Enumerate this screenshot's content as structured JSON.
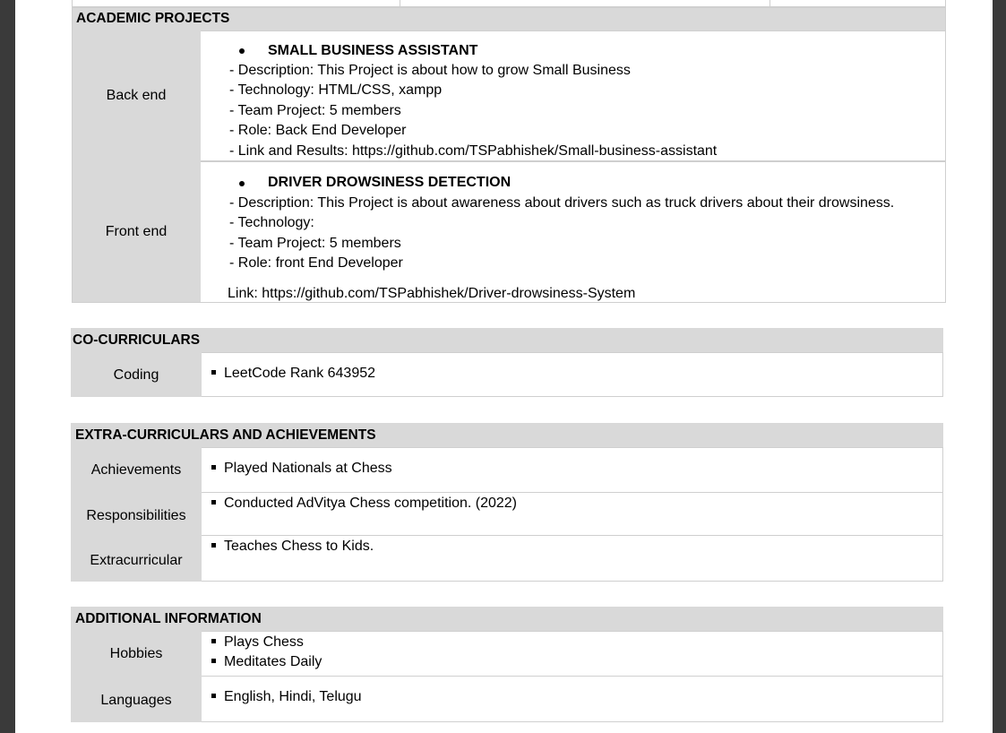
{
  "academic_projects": {
    "header": "ACADEMIC PROJECTS",
    "rows": [
      {
        "label": "Back end",
        "title": "SMALL BUSINESS ASSISTANT",
        "lines": [
          "- Description: This Project is about how to grow Small Business",
          "- Technology: HTML/CSS, xampp",
          "- Team Project: 5 members",
          "- Role:  Back End Developer",
          "- Link and Results: https://github.com/TSPabhishek/Small-business-assistant"
        ]
      },
      {
        "label": "Front end",
        "title": "DRIVER DROWSINESS DETECTION",
        "lines": [
          "- Description: This Project is about awareness about drivers such as truck drivers about their drowsiness.",
          "- Technology:",
          "- Team Project: 5 members",
          "- Role:  front End Developer"
        ],
        "link": "Link: https://github.com/TSPabhishek/Driver-drowsiness-System"
      }
    ]
  },
  "co_curriculars": {
    "header": "CO-CURRICULARS",
    "rows": [
      {
        "label": "Coding",
        "items": [
          "LeetCode Rank 643952"
        ]
      }
    ]
  },
  "extra_curriculars": {
    "header": "EXTRA-CURRICULARS AND ACHIEVEMENTS",
    "rows": [
      {
        "label": "Achievements",
        "items": [
          "Played Nationals at Chess"
        ]
      },
      {
        "label": "Responsibilities",
        "items": [
          "Conducted AdVitya Chess competition. (2022)"
        ]
      },
      {
        "label": "Extracurricular",
        "items": [
          "Teaches Chess to Kids."
        ]
      }
    ]
  },
  "additional_info": {
    "header": "ADDITIONAL INFORMATION",
    "rows": [
      {
        "label": "Hobbies",
        "items": [
          "Plays Chess",
          "Meditates Daily"
        ]
      },
      {
        "label": "Languages",
        "items": [
          "English, Hindi, Telugu"
        ]
      }
    ]
  }
}
